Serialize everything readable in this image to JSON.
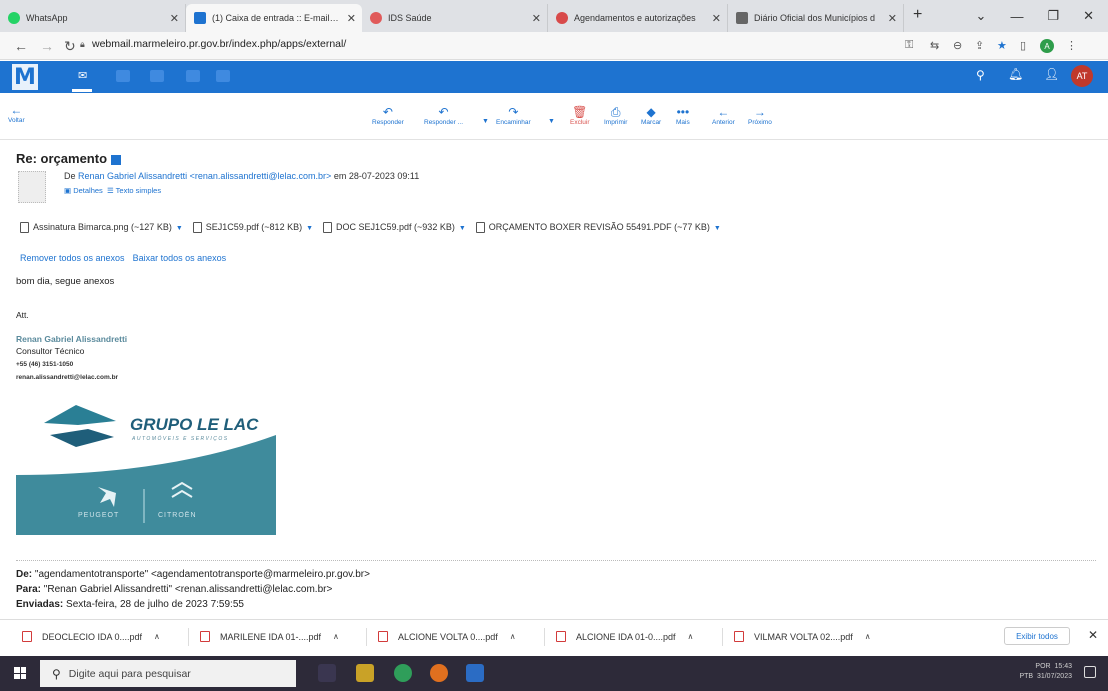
{
  "browser": {
    "tabs": [
      {
        "label": "WhatsApp",
        "color": "#25d366",
        "active": false
      },
      {
        "label": "(1) Caixa de entrada :: E-mail - n",
        "color": "#1e73d0",
        "active": true
      },
      {
        "label": "IDS Saúde",
        "color": "#e05a5a",
        "active": false
      },
      {
        "label": "Agendamentos e autorizações",
        "color": "#d84a4a",
        "active": false
      },
      {
        "label": "Diário Oficial dos Municípios d",
        "color": "#666666",
        "active": false
      }
    ],
    "url": "webmail.marmeleiro.pr.gov.br/index.php/apps/external/",
    "profile_initial": "A"
  },
  "app": {
    "user_initials": "AT",
    "toolbar": {
      "back": "Voltar",
      "reply": "Responder",
      "reply_all": "Responder ...",
      "forward": "Encaminhar",
      "delete": "Excluir",
      "print": "Imprimir",
      "mark": "Marcar",
      "more": "Mais",
      "previous": "Anterior",
      "next": "Próximo"
    }
  },
  "email": {
    "subject": "Re: orçamento",
    "from_prefix": "De",
    "from_name": "Renan Gabriel Alissandretti <renan.alissandretti@lelac.com.br>",
    "date_text": "em 28-07-2023 09:11",
    "details_label": "Detalhes",
    "plain_text_label": "Texto simples",
    "attachments": [
      "Assinatura Bimarca.png (~127 KB)",
      "SEJ1C59.pdf (~812 KB)",
      "DOC SEJ1C59.pdf (~932 KB)",
      "ORÇAMENTO BOXER REVISÃO 55491.PDF (~77 KB)"
    ],
    "remove_all": "Remover todos os anexos",
    "download_all": "Baixar todos os anexos",
    "body_line": "bom dia, segue anexos",
    "closing": "Att.",
    "signature": {
      "name": "Renan Gabriel Alissandretti",
      "role": "Consultor Técnico",
      "phone": "+55 (46) 3151-1050",
      "email": "renan.alissandretti@lelac.com.br",
      "brand": "GRUPO LE LAC",
      "brand_sub": "AUTOMÓVEIS E SERVIÇOS",
      "peugeot": "PEUGEOT",
      "citroen": "CITROËN"
    },
    "quoted": {
      "from_label": "De:",
      "from_value": "\"agendamentotransporte\" <agendamentotransporte@marmeleiro.pr.gov.br>",
      "to_label": "Para:",
      "to_value": "\"Renan Gabriel Alissandretti\" <renan.alissandretti@lelac.com.br>",
      "sent_label": "Enviadas:",
      "sent_value": "Sexta-feira, 28 de julho de 2023 7:59:55"
    }
  },
  "downloads": {
    "items": [
      "DEOCLECIO IDA 0....pdf",
      "MARILENE IDA 01-....pdf",
      "ALCIONE VOLTA 0....pdf",
      "ALCIONE IDA 01-0....pdf",
      "VILMAR VOLTA 02....pdf"
    ],
    "show_all": "Exibir todos"
  },
  "taskbar": {
    "search_placeholder": "Digite aqui para pesquisar",
    "lang1": "POR",
    "lang2": "PTB",
    "time": "15:43",
    "date": "31/07/2023"
  }
}
